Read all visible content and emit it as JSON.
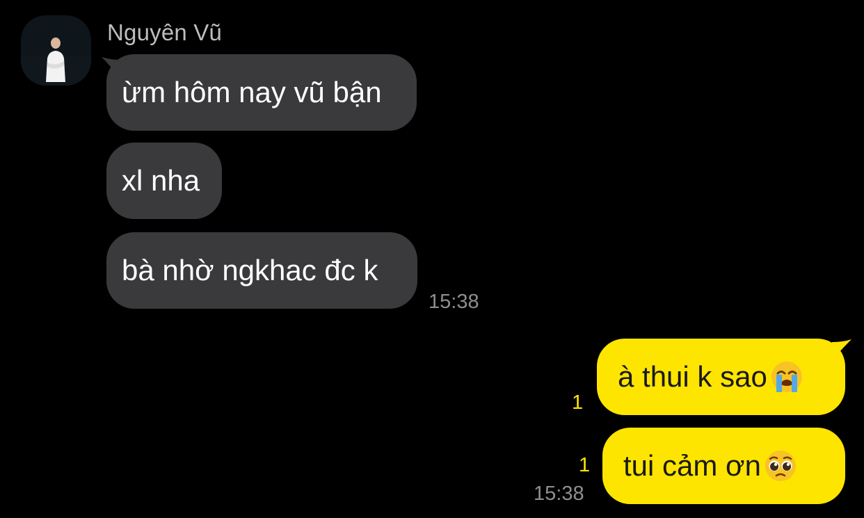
{
  "chat": {
    "sender_name": "Nguyên Vũ",
    "incoming": [
      {
        "text": "ừm hôm nay vũ bận"
      },
      {
        "text": "xl nha"
      },
      {
        "text": "bà nhờ ngkhac đc k"
      }
    ],
    "incoming_time": "15:38",
    "outgoing": [
      {
        "text": "à thui k sao",
        "emoji": "loudly-crying-face-icon",
        "unread_count": "1"
      },
      {
        "text": "tui cảm ơn ",
        "emoji": "pleading-face-icon",
        "unread_count": "1"
      }
    ],
    "outgoing_time": "15:38"
  },
  "colors": {
    "background": "#000000",
    "incoming_bubble": "#3a3a3c",
    "outgoing_bubble": "#fee500",
    "unread_counter": "#fee500",
    "time_text": "#8e8e8e"
  }
}
